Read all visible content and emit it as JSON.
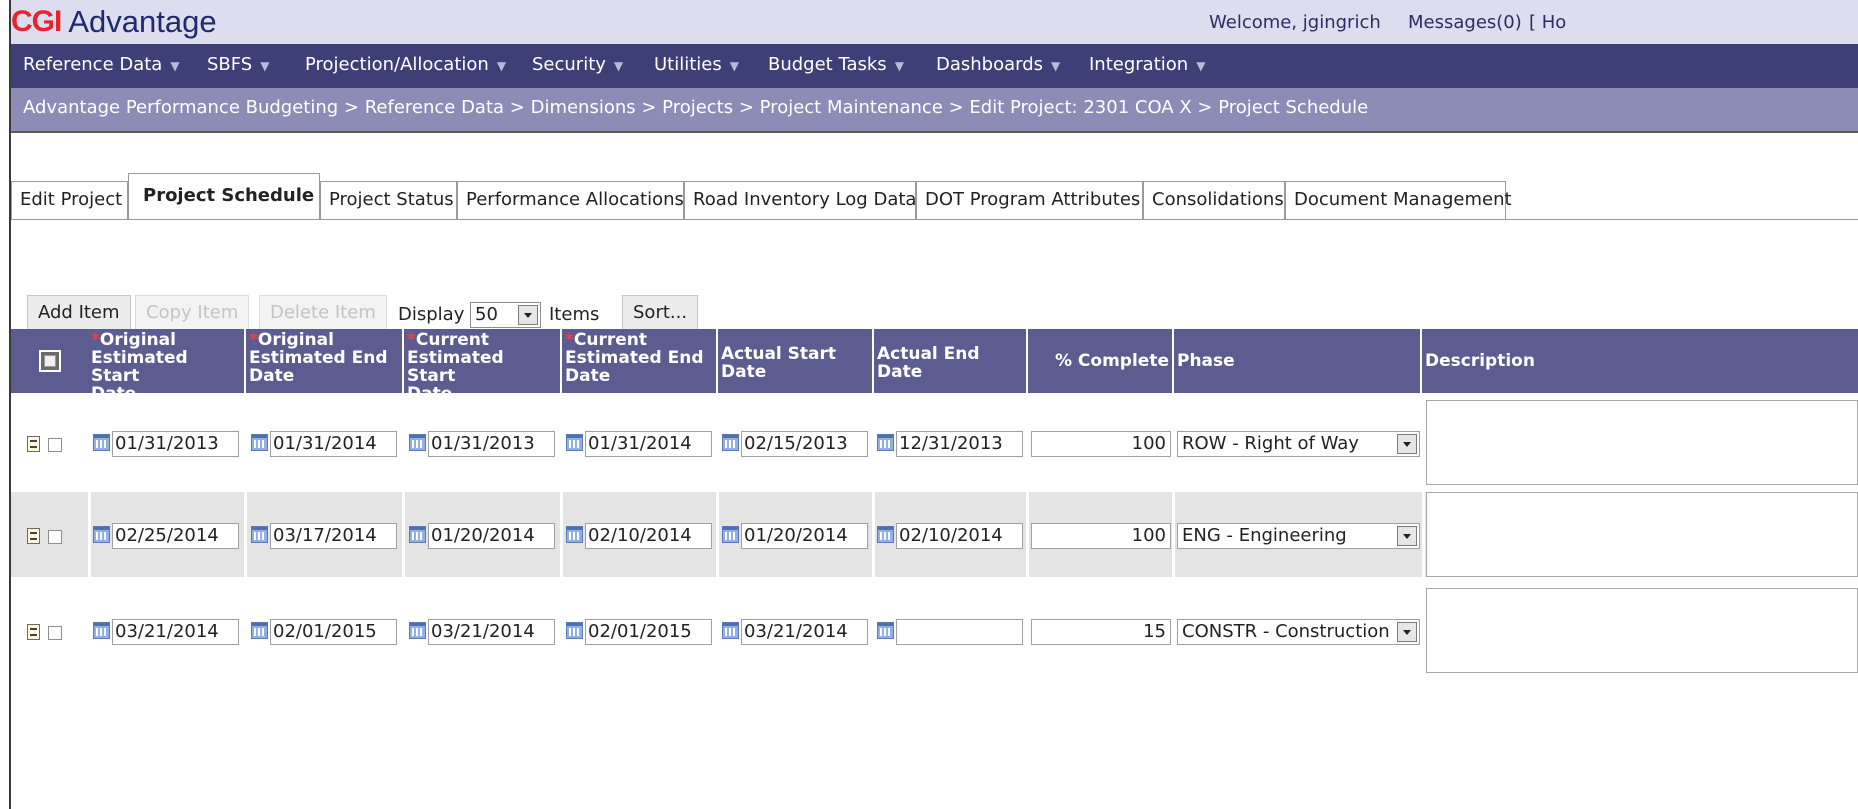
{
  "header": {
    "logo_cgi": "CGI",
    "logo_app": "Advantage",
    "welcome": "Welcome, jgingrich",
    "messages": "Messages(0)",
    "home_fragment": "[ Ho"
  },
  "menu": {
    "items": [
      {
        "label": "Reference Data"
      },
      {
        "label": "SBFS"
      },
      {
        "label": "Projection/Allocation"
      },
      {
        "label": "Security"
      },
      {
        "label": "Utilities"
      },
      {
        "label": "Budget Tasks"
      },
      {
        "label": "Dashboards"
      },
      {
        "label": "Integration"
      }
    ]
  },
  "breadcrumb": "Advantage Performance Budgeting > Reference Data > Dimensions > Projects > Project Maintenance > Edit Project: 2301 COA X > Project Schedule",
  "tabs": [
    {
      "label": "Edit Project"
    },
    {
      "label": "Project Schedule",
      "active": true
    },
    {
      "label": "Project Status"
    },
    {
      "label": "Performance Allocations"
    },
    {
      "label": "Road Inventory Log Data"
    },
    {
      "label": "DOT Program Attributes"
    },
    {
      "label": "Consolidations"
    },
    {
      "label": "Document Management"
    }
  ],
  "toolbar": {
    "add_item": "Add Item",
    "copy_item": "Copy Item",
    "delete_item": "Delete Item",
    "display_label": "Display",
    "display_value": "50",
    "items_label": "Items",
    "sort": "Sort..."
  },
  "columns": [
    {
      "l1": "Original",
      "l2": "Estimated Start",
      "l3": "Date",
      "required": true
    },
    {
      "l1": "Original",
      "l2": "Estimated End",
      "l3": "Date",
      "required": true
    },
    {
      "l1": "Current",
      "l2": "Estimated Start",
      "l3": "Date",
      "required": true
    },
    {
      "l1": "Current",
      "l2": "Estimated End",
      "l3": "Date",
      "required": true
    },
    {
      "l1": "Actual Start",
      "l2": "Date"
    },
    {
      "l1": "Actual End",
      "l2": "Date"
    },
    {
      "l1": "% Complete"
    },
    {
      "l1": "Phase"
    },
    {
      "l1": "Description"
    }
  ],
  "required_marker": "*",
  "rows": [
    {
      "orig_start": "01/31/2013",
      "orig_end": "01/31/2014",
      "cur_start": "01/31/2013",
      "cur_end": "01/31/2014",
      "act_start": "02/15/2013",
      "act_end": "12/31/2013",
      "pct": "100",
      "phase": "ROW - Right of Way",
      "description": ""
    },
    {
      "orig_start": "02/25/2014",
      "orig_end": "03/17/2014",
      "cur_start": "01/20/2014",
      "cur_end": "02/10/2014",
      "act_start": "01/20/2014",
      "act_end": "02/10/2014",
      "pct": "100",
      "phase": "ENG - Engineering",
      "description": ""
    },
    {
      "orig_start": "03/21/2014",
      "orig_end": "02/01/2015",
      "cur_start": "03/21/2014",
      "cur_end": "02/01/2015",
      "act_start": "03/21/2014",
      "act_end": "",
      "pct": "15",
      "phase": "CONSTR - Construction",
      "description": ""
    }
  ],
  "colors": {
    "header_bg": "#dedcef",
    "menu_bg": "#3f3f77",
    "breadcrumb_bg": "#8c8cb7",
    "grid_header_bg": "#5c5c90",
    "alt_row_bg": "#e4e4e4",
    "brand_red": "#e3262c",
    "brand_navy": "#1d2a6b"
  },
  "icons": [
    "doc-icon",
    "calendar-icon",
    "dropdown-arrow-icon",
    "caret-down-icon"
  ]
}
